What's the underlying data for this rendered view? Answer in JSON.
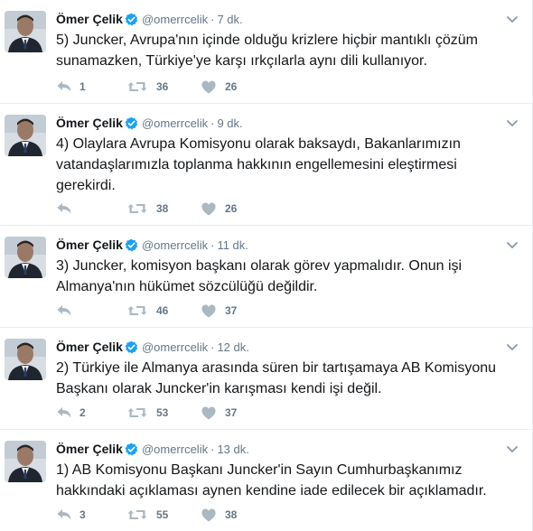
{
  "colors": {
    "text": "#14171a",
    "secondary": "#657786",
    "verified": "#1da1f2",
    "divider": "#e6ecf0"
  },
  "icons": [
    "avatar-photo",
    "verified-badge-icon",
    "chevron-down-icon",
    "reply-icon",
    "retweet-icon",
    "heart-icon"
  ],
  "tweets": [
    {
      "name": "Ömer Çelik",
      "handle": "@omerrcelik",
      "separator": "·",
      "time": "7 dk.",
      "text": "5) Juncker, Avrupa'nın içinde olduğu krizlere hiçbir mantıklı çözüm sunamazken, Türkiye'ye karşı ırkçılarla aynı dili kullanıyor.",
      "replies": "1",
      "retweets": "36",
      "likes": "26"
    },
    {
      "name": "Ömer Çelik",
      "handle": "@omerrcelik",
      "separator": "·",
      "time": "9 dk.",
      "text": "4) Olaylara Avrupa Komisyonu olarak baksaydı, Bakanlarımızın vatandaşlarımızla toplanma hakkının engellemesini eleştirmesi gerekirdi.",
      "replies": "",
      "retweets": "38",
      "likes": "26"
    },
    {
      "name": "Ömer Çelik",
      "handle": "@omerrcelik",
      "separator": "·",
      "time": "11 dk.",
      "text": "3) Juncker, komisyon başkanı olarak görev yapmalıdır. Onun işi Almanya'nın hükümet sözcülüğü değildir.",
      "replies": "",
      "retweets": "46",
      "likes": "37"
    },
    {
      "name": "Ömer Çelik",
      "handle": "@omerrcelik",
      "separator": "·",
      "time": "12 dk.",
      "text": "2) Türkiye ile Almanya arasında süren bir tartışamaya AB Komisyonu Başkanı olarak Juncker'in karışması kendi işi değil.",
      "replies": "2",
      "retweets": "53",
      "likes": "37"
    },
    {
      "name": "Ömer Çelik",
      "handle": "@omerrcelik",
      "separator": "·",
      "time": "13 dk.",
      "text": "1) AB Komisyonu Başkanı Juncker'in Sayın Cumhurbaşkanımız hakkındaki açıklaması aynen kendine iade edilecek bir açıklamadır.",
      "replies": "3",
      "retweets": "55",
      "likes": "38"
    }
  ]
}
